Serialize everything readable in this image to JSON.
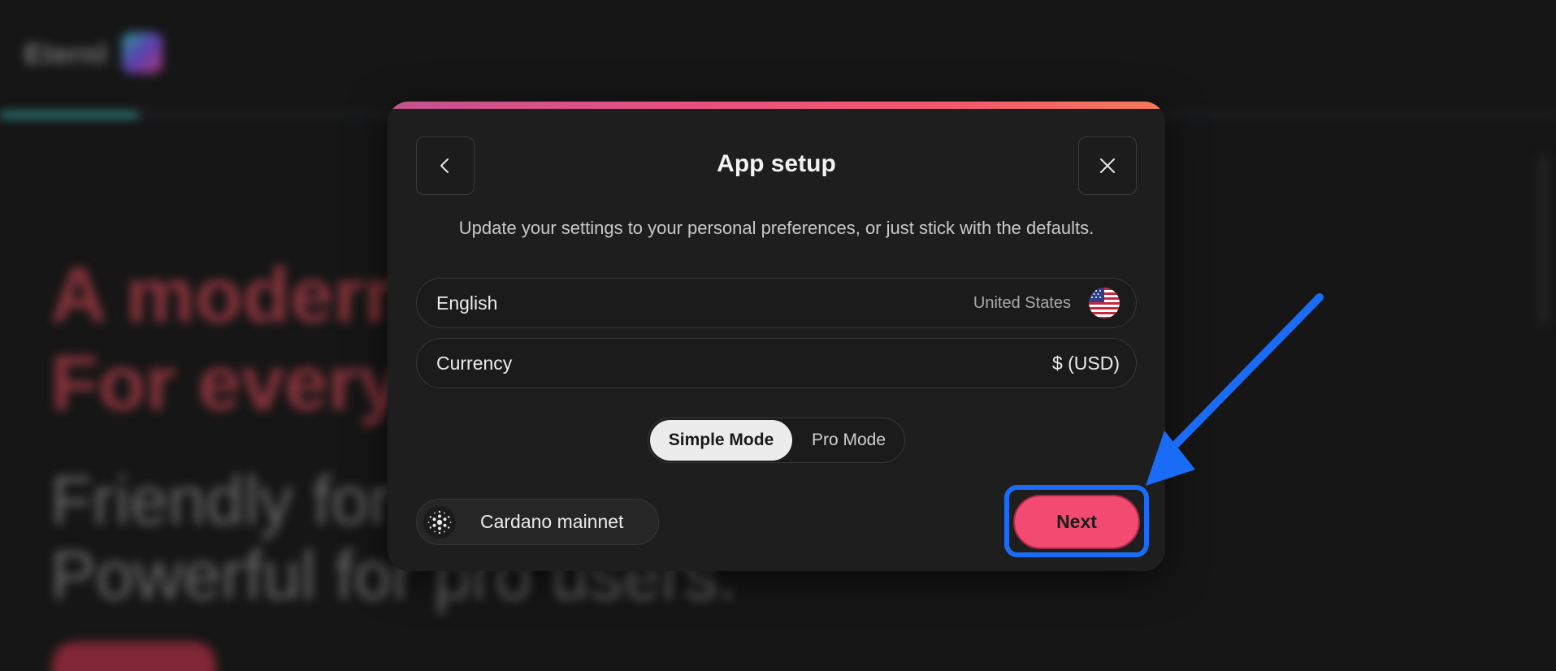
{
  "background": {
    "logo": "Eternl",
    "headline_lines": [
      "A modern",
      "For every"
    ],
    "subheadline_lines": [
      "Friendly for",
      "Powerful for pro users."
    ]
  },
  "modal": {
    "title": "App setup",
    "subtitle": "Update your settings to your personal preferences, or just stick with the defaults.",
    "back_icon": "chevron-left-icon",
    "close_icon": "close-icon",
    "language": {
      "label": "English",
      "region": "United States",
      "flag_icon": "us-flag-icon"
    },
    "currency": {
      "label": "Currency",
      "value": "$ (USD)"
    },
    "mode": {
      "options": [
        "Simple Mode",
        "Pro Mode"
      ],
      "selected": "Simple Mode"
    },
    "network": {
      "label": "Cardano mainnet",
      "icon": "cardano-icon"
    },
    "next_label": "Next"
  },
  "annotation": {
    "highlight_color": "#1a6cf7",
    "arrow_color": "#1a6cf7",
    "target": "Next"
  },
  "colors": {
    "accent": "#f24a71",
    "modal_bg": "#1e1e1e",
    "page_bg": "#161616",
    "topbar_gradient": [
      "#c4538f",
      "#f25a6b",
      "#f57b59"
    ]
  }
}
